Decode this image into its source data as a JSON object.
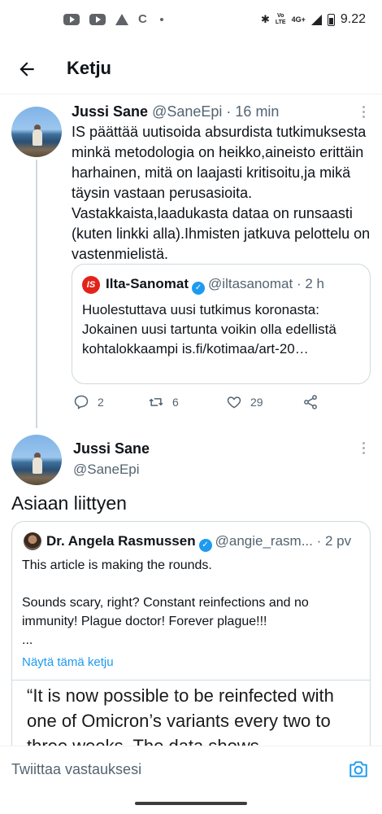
{
  "status_bar": {
    "time": "9.22",
    "network": "4G+",
    "volte": "Vo\nLTE",
    "bluetooth_icon": "bluetooth-icon"
  },
  "header": {
    "title": "Ketju"
  },
  "tweet1": {
    "name": "Jussi Sane",
    "handle": "@SaneEpi",
    "time": "· 16 min",
    "text": "IS päättää uutisoida absurdista tutkimuksesta minkä metodologia on heikko,aineisto erittäin harhainen, mitä on laajasti kritisoitu,ja mikä täysin vastaan perusasioita. Vastakkaista,laadukasta dataa on runsaasti (kuten linkki alla).Ihmisten jatkuva pelottelu on vastenmielistä.",
    "quote": {
      "logo": "IS",
      "name": "Ilta-Sanomat",
      "handle": "@iltasanomat",
      "time": "· 2 h",
      "text": "Huolestuttava uusi tutkimus koronasta: Jokainen uusi tartunta voikin olla edellistä kohtalokkaampi is.fi/kotimaa/art-20…"
    },
    "actions": {
      "replies": "2",
      "retweets": "6",
      "likes": "29"
    }
  },
  "tweet2": {
    "name": "Jussi Sane",
    "handle": "@SaneEpi",
    "text": "Asiaan liittyen",
    "quote": {
      "name": "Dr. Angela Rasmussen",
      "handle": "@angie_rasm...",
      "time": "· 2 pv",
      "text": "This article is making the rounds.\n\nSounds scary, right? Constant reinfections and no immunity! Plague doctor! Forever plague!!!\n...",
      "show_thread": "Näytä tämä ketju",
      "image_text": "“It is now possible to be reinfected with one of Omicron’s variants every two to three weeks. The data shows"
    }
  },
  "reply_bar": {
    "placeholder": "Twiittaa vastauksesi"
  },
  "colors": {
    "accent": "#1d9bf0",
    "text": "#0f1419",
    "secondary": "#536471",
    "border": "#cfd9de"
  }
}
